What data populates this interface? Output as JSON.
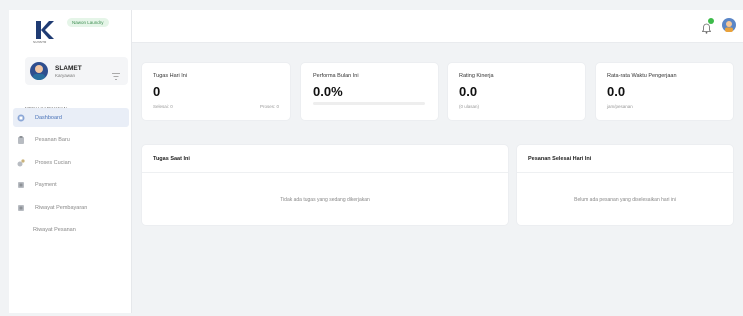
{
  "sidebar": {
    "logo_caption": "SUNSTR",
    "brand_badge": "Nawon Laundry",
    "user": {
      "name": "SLAMET",
      "role": "Karyawan"
    },
    "menu_title": "MENU KARYAWAN",
    "items": [
      {
        "label": "Dashboard",
        "icon": "dashboard-icon",
        "active": true
      },
      {
        "label": "Pesanan Baru",
        "icon": "clipboard-icon"
      },
      {
        "label": "Proses Cucian",
        "icon": "laundry-icon"
      },
      {
        "label": "Payment",
        "icon": "payment-icon"
      },
      {
        "label": "Riwayat Pembayaran",
        "icon": "history-icon"
      },
      {
        "label": "Riwayat Pesanan",
        "icon": ""
      }
    ]
  },
  "topbar": {
    "notification_icon": "bell-icon",
    "avatar_icon": "user-avatar-icon"
  },
  "stats": [
    {
      "label": "Tugas Hari Ini",
      "value": "0",
      "sub_left": "Selesai: 0",
      "sub_right": "Proses: 0"
    },
    {
      "label": "Performa Bulan Ini",
      "value": "0.0%",
      "progress": 0
    },
    {
      "label": "Rating Kinerja",
      "value": "0.0",
      "sub_left": "(0 ulasan)"
    },
    {
      "label": "Rata-rata Waktu Pengerjaan",
      "value": "0.0",
      "sub_left": "jam/pesanan"
    }
  ],
  "panels": {
    "current_tasks": {
      "title": "Tugas Saat Ini",
      "empty": "Tidak ada tugas yang sedang dikerjakan"
    },
    "completed_orders": {
      "title": "Pesanan Selesai Hari Ini",
      "empty": "Belum ada pesanan yang diselesaikan hari ini"
    }
  },
  "colors": {
    "accent": "#4a73b8",
    "active_bg": "#e9eef7",
    "badge_green": "#3c8d50",
    "dot_green": "#3dbb4a"
  }
}
